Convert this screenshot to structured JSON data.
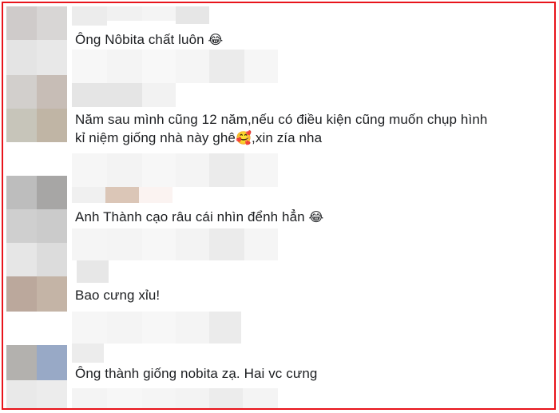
{
  "comments": [
    {
      "text": "Ông Nôbita chất luôn",
      "emoji": "😂"
    },
    {
      "line1": "Năm sau mình cũng 12 năm,nếu có điều kiện cũng muốn chụp hình",
      "line2_a": "kỉ niệm giống nhà này ghê",
      "line2_emoji": "🥰",
      "line2_b": ",xin zía nha"
    },
    {
      "text": "Anh Thành cạo râu cái nhìn đểnh hẳn",
      "emoji": "😂"
    },
    {
      "text": "Bao cưng xỉu!"
    },
    {
      "text": "Ông thành giống nobita zạ. Hai vc cưng"
    }
  ],
  "colors": {
    "frame_border": "#e8141b",
    "text": "#1c1e21"
  }
}
